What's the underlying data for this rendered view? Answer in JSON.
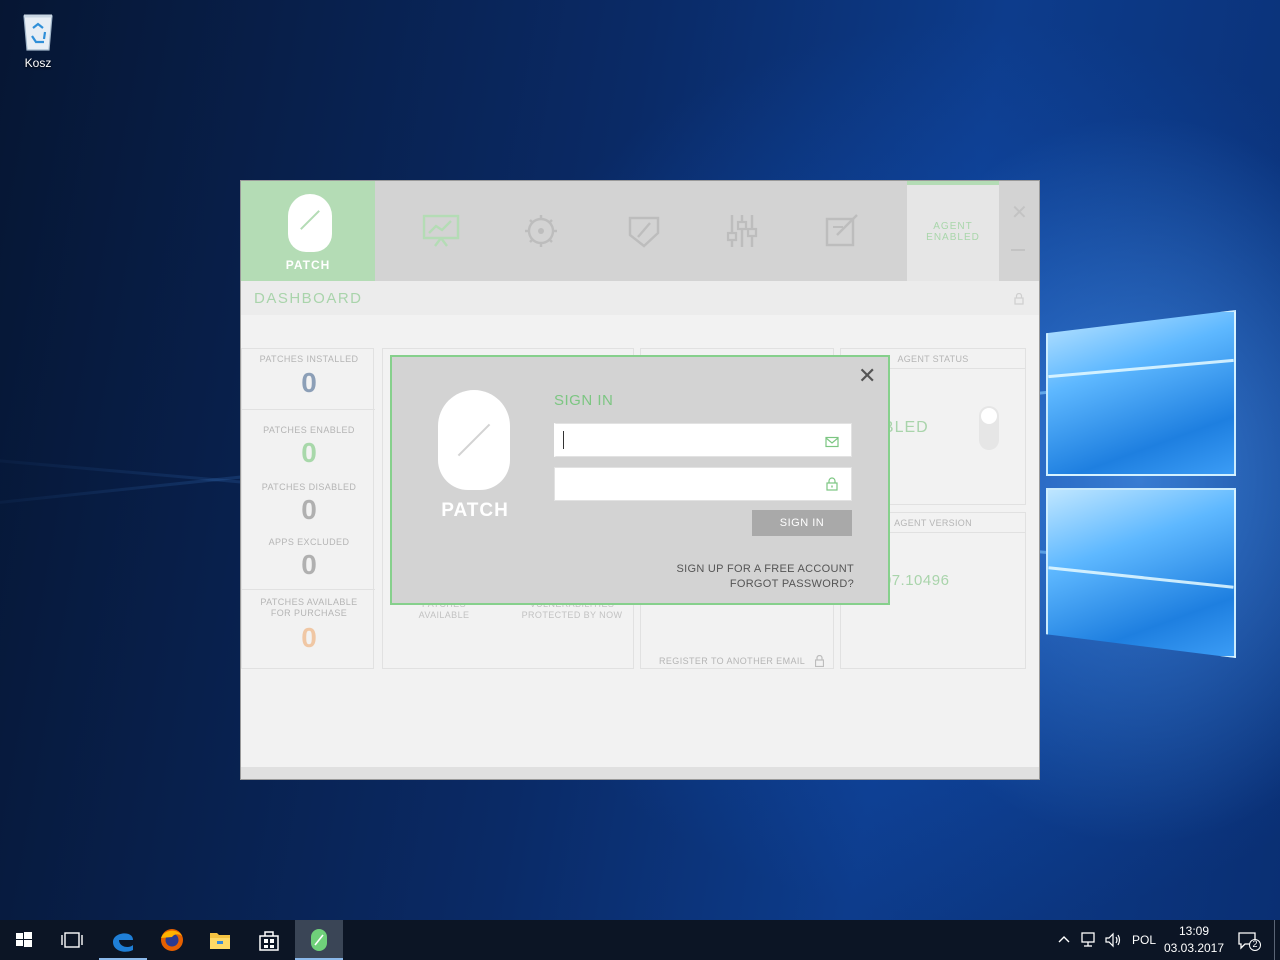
{
  "desktop": {
    "recycle_bin_label": "Kosz",
    "recycle_bin_icon": "recycle-bin-icon"
  },
  "app": {
    "brand": "PATCH",
    "nav_icons": [
      "dashboard-chart-icon",
      "settings-gear-icon",
      "shield-icon",
      "sliders-icon",
      "edit-note-icon"
    ],
    "agent_tab_label_line1": "AGENT",
    "agent_tab_label_line2": "ENABLED",
    "section_title": "DASHBOARD",
    "accent_color": "#b4dcb5",
    "stats": [
      {
        "label": "PATCHES INSTALLED",
        "value": "0",
        "color": "#8c9fb7"
      },
      {
        "label": "PATCHES ENABLED",
        "value": "0",
        "color": "#a8d8aa"
      },
      {
        "label": "PATCHES DISABLED",
        "value": "0",
        "color": "#b0b0b0"
      },
      {
        "label": "APPS EXCLUDED",
        "value": "0",
        "color": "#b0b0b0"
      },
      {
        "label_line1": "PATCHES AVAILABLE",
        "label_line2": "FOR PURCHASE",
        "value": "0",
        "color": "#f0c7a4"
      }
    ],
    "middle_card": {
      "label1_line1": "PATCHES",
      "label1_line2": "AVAILABLE",
      "label2_line1": "VULNERABILITIES",
      "label2_line2": "PROTECTED BY NOW"
    },
    "register_link": "REGISTER TO ANOTHER EMAIL",
    "agent_status_title": "AGENT STATUS",
    "agent_status_value": "ENABLED",
    "agent_version_title": "AGENT VERSION",
    "agent_version_value": "7.02.07.10496"
  },
  "signin": {
    "brand": "PATCH",
    "title": "SIGN IN",
    "email_value": "",
    "password_value": "",
    "email_icon": "envelope-icon",
    "password_icon": "lock-icon",
    "button_label": "SIGN IN",
    "signup_link": "SIGN UP FOR A FREE ACCOUNT",
    "forgot_link": "FORGOT PASSWORD?",
    "border_color": "#86d08c"
  },
  "taskbar": {
    "items": [
      "start-icon",
      "task-view-icon",
      "edge-icon",
      "firefox-icon",
      "file-explorer-icon",
      "store-icon",
      "patch-app-icon"
    ],
    "language": "POL",
    "time": "13:09",
    "date": "03.03.2017",
    "notification_count": "2"
  }
}
